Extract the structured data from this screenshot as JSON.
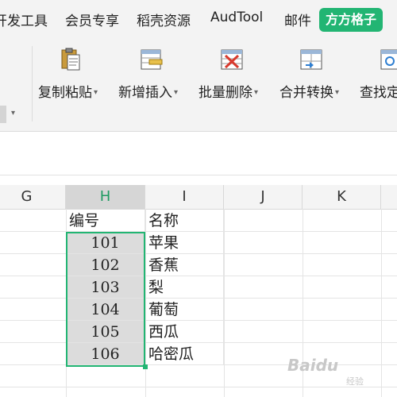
{
  "menu": {
    "items": [
      "开发工具",
      "会员专享",
      "稻壳资源",
      "AudTool",
      "邮件"
    ],
    "active": "方方格子"
  },
  "ribbon": {
    "tools": [
      {
        "label": "复制粘贴",
        "icon": "clipboard-paste-icon"
      },
      {
        "label": "新增插入",
        "icon": "insert-rows-icon"
      },
      {
        "label": "批量删除",
        "icon": "batch-delete-icon"
      },
      {
        "label": "合并转换",
        "icon": "merge-convert-icon"
      },
      {
        "label": "查找定",
        "icon": "find-locate-icon"
      }
    ],
    "caret": "▾"
  },
  "grid": {
    "columns": [
      "G",
      "H",
      "I",
      "J",
      "K"
    ],
    "selected_column": "H",
    "header_row": {
      "H": "编号",
      "I": "名称"
    },
    "rows": [
      {
        "H": "101",
        "I": "苹果"
      },
      {
        "H": "102",
        "I": "香蕉"
      },
      {
        "H": "103",
        "I": "梨"
      },
      {
        "H": "104",
        "I": "葡萄"
      },
      {
        "H": "105",
        "I": "西瓜"
      },
      {
        "H": "106",
        "I": "哈密瓜"
      }
    ]
  },
  "watermark": {
    "text": "Baidu",
    "sub": "经验"
  },
  "colors": {
    "accent": "#22b573",
    "selected_header": "#d6d6d6",
    "selected_cells": "#dcdcdc"
  }
}
